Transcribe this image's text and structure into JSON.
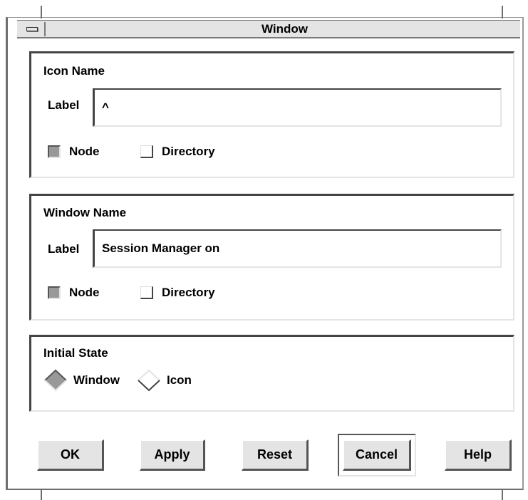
{
  "window": {
    "title": "Window"
  },
  "icon_name": {
    "heading": "Icon Name",
    "label_text": "Label",
    "label_value": "^",
    "node_label": "Node",
    "node_checked": true,
    "directory_label": "Directory",
    "directory_checked": false
  },
  "window_name": {
    "heading": "Window Name",
    "label_text": "Label",
    "label_value": "Session Manager on",
    "node_label": "Node",
    "node_checked": true,
    "directory_label": "Directory",
    "directory_checked": false
  },
  "initial_state": {
    "heading": "Initial State",
    "options": [
      "Window",
      "Icon"
    ],
    "selected": "Window"
  },
  "buttons": {
    "ok": "OK",
    "apply": "Apply",
    "reset": "Reset",
    "cancel": "Cancel",
    "help": "Help",
    "default": "Cancel"
  },
  "colors": {
    "face": "#e4e4e4",
    "shadow": "#444444",
    "fill": "#999999"
  }
}
